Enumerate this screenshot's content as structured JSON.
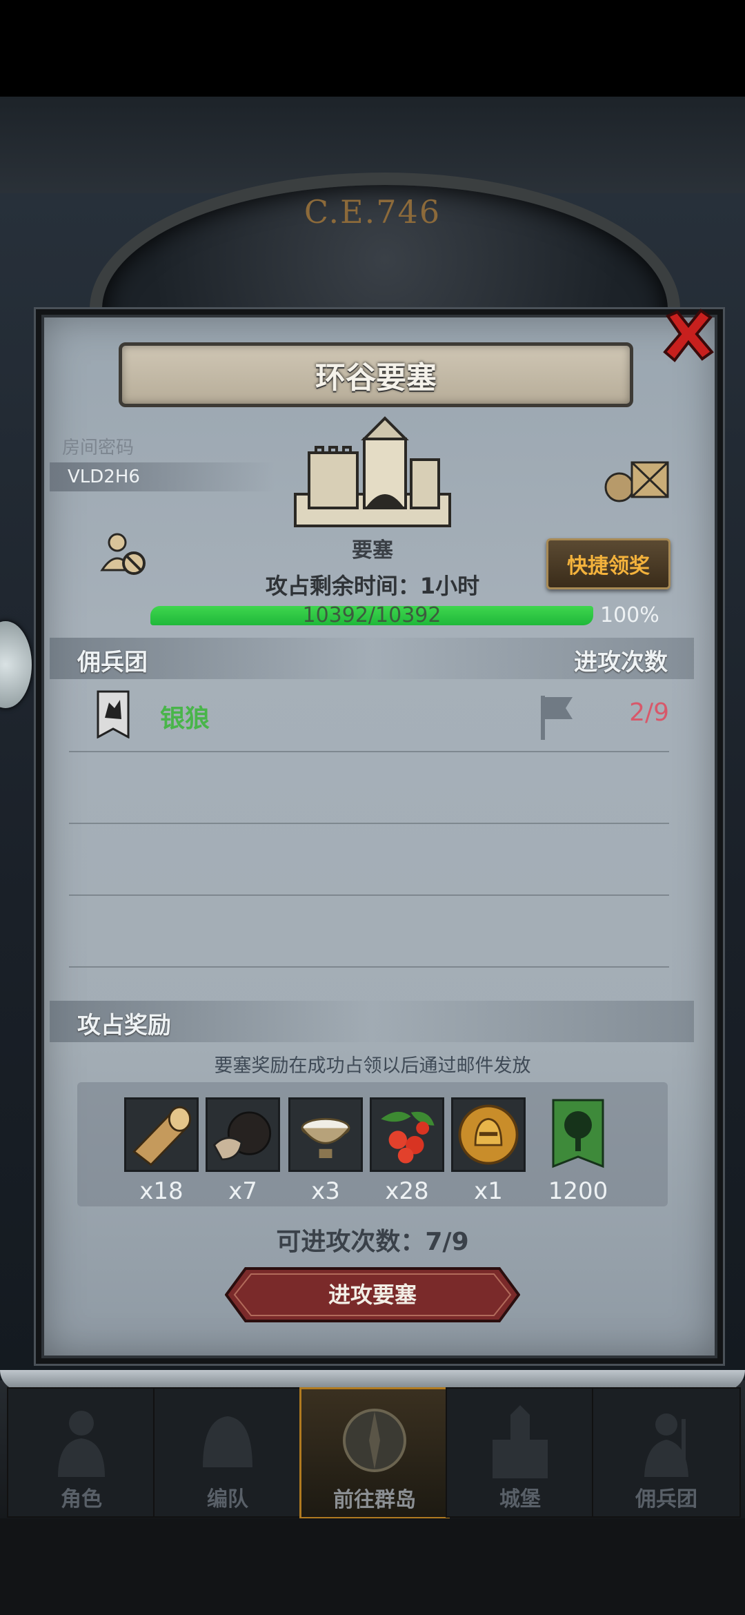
{
  "header": {
    "era": "C.E.746"
  },
  "dialog": {
    "title": "环谷要塞",
    "room_label": "房间密码",
    "room_code": "VLD2H6",
    "building_label": "要塞",
    "quick_claim_label": "快捷领奖",
    "time_left": "攻占剩余时间：1小时",
    "hp": {
      "text": "10392/10392",
      "percent_text": "100%",
      "fraction": 1.0
    },
    "table": {
      "col_left": "佣兵团",
      "col_right": "进攻次数",
      "rows": [
        {
          "name": "银狼",
          "attacks": "2/9"
        }
      ]
    },
    "rewards": {
      "header": "攻占奖励",
      "note": "要塞奖励在成功占领以后通过邮件发放",
      "items": [
        {
          "icon": "wood-log-icon",
          "qty": "x18"
        },
        {
          "icon": "truffle-icon",
          "qty": "x7"
        },
        {
          "icon": "milk-bowl-icon",
          "qty": "x3"
        },
        {
          "icon": "berries-icon",
          "qty": "x28"
        },
        {
          "icon": "gold-helmet-coin-icon",
          "qty": "x1"
        },
        {
          "icon": "green-tree-banner-icon",
          "qty": "1200"
        }
      ]
    },
    "attacks_left": "可进攻次数：7/9",
    "attack_button": "进攻要塞"
  },
  "nav": {
    "items": [
      {
        "label": "角色",
        "icon": "knight-icon"
      },
      {
        "label": "编队",
        "icon": "helmet-icon"
      },
      {
        "label": "前往群岛",
        "icon": "compass-icon",
        "active": true
      },
      {
        "label": "城堡",
        "icon": "castle-icon"
      },
      {
        "label": "佣兵团",
        "icon": "mercenary-icon"
      }
    ]
  },
  "colors": {
    "hp_green": "#1fb83a",
    "merc_green": "#49b54a",
    "attack_red": "#d8586a",
    "quick_gold": "#f3b23c",
    "attack_button": "#7a2a2a"
  }
}
